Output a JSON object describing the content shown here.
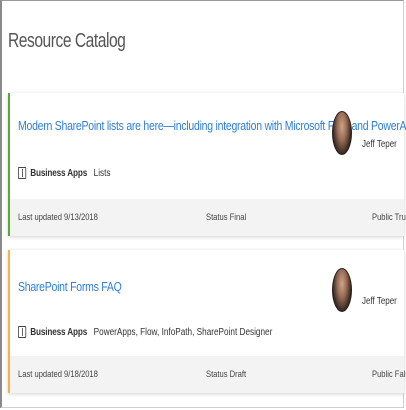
{
  "page": {
    "title": "Resource Catalog"
  },
  "cards": [
    {
      "title": "Modern SharePoint lists are here—including integration with Microsoft Flow and PowerApps",
      "category": "Business Apps",
      "tags": "Lists",
      "author": "Jeff Teper",
      "last_updated": "Last updated 9/13/2018",
      "status": "Status Final",
      "public": "Public True",
      "accent_color": "#5aa83b"
    },
    {
      "title": "SharePoint Forms FAQ",
      "category": "Business Apps",
      "tags": "PowerApps, Flow, InfoPath, SharePoint Designer",
      "author": "Jeff Teper",
      "last_updated": "Last updated 9/18/2018",
      "status": "Status Draft",
      "public": "Public False",
      "accent_color": "#f4b34c"
    }
  ],
  "icons": {
    "category": "bucket-icon"
  },
  "colors": {
    "link": "#2f7fd6",
    "footer_bg": "#f3f3f3"
  }
}
